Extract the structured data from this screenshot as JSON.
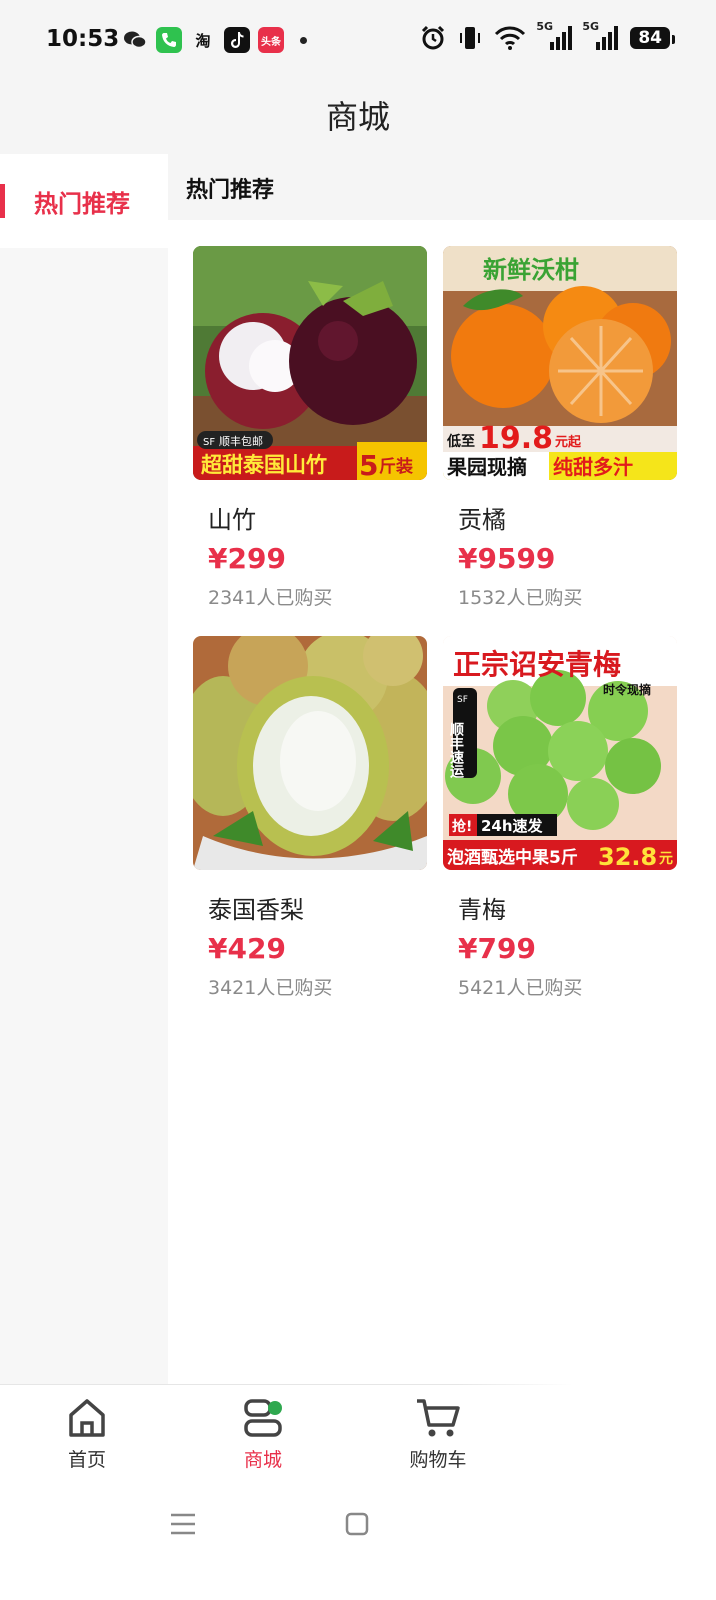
{
  "status_bar": {
    "time": "10:53",
    "apps": [
      "wechat-icon",
      "phone-icon",
      "taobao-icon",
      "tiktok-icon",
      "toutiao-icon"
    ],
    "taobao_label": "淘",
    "toutiao_label": "头条",
    "signal_label_1": "5G",
    "signal_label_2": "5G",
    "battery": "84"
  },
  "header": {
    "title": "商城"
  },
  "sidebar": {
    "items": [
      {
        "label": "热门推荐",
        "active": true
      }
    ]
  },
  "section": {
    "title": "热门推荐"
  },
  "products": [
    {
      "name": "山竹",
      "price": "¥299",
      "sold": "2341人已购买",
      "image_texts": {
        "badge": "顺丰包邮",
        "sf": "SF",
        "banner": "超甜泰国山竹",
        "banner_num": "5",
        "banner_unit": "斤装"
      }
    },
    {
      "name": "贡橘",
      "price": "¥9599",
      "sold": "1532人已购买",
      "image_texts": {
        "top": "新鲜沃柑",
        "low_prefix": "低至",
        "low_price": "19.8",
        "low_suffix": "元起",
        "banner_left": "果园现摘",
        "banner_right": "纯甜多汁"
      }
    },
    {
      "name": "泰国香梨",
      "price": "¥429",
      "sold": "3421人已购买",
      "image_texts": {}
    },
    {
      "name": "青梅",
      "price": "¥799",
      "sold": "5421人已购买",
      "image_texts": {
        "top": "正宗诏安青梅",
        "sub": "时令现摘",
        "side": "顺丰速运",
        "sf": "SF",
        "grab": "抢!",
        "fast": "24h速发",
        "banner": "泡酒甄选中果5斤",
        "banner_price": "32.8",
        "banner_unit": "元"
      }
    }
  ],
  "tabbar": {
    "tabs": [
      {
        "label": "首页",
        "icon": "home-icon",
        "active": false
      },
      {
        "label": "商城",
        "icon": "store-icon",
        "active": true
      },
      {
        "label": "购物车",
        "icon": "cart-icon",
        "active": false
      }
    ]
  },
  "colors": {
    "accent": "#e8304a",
    "bg_gray": "#f5f5f5",
    "muted": "#8a8a8a"
  }
}
